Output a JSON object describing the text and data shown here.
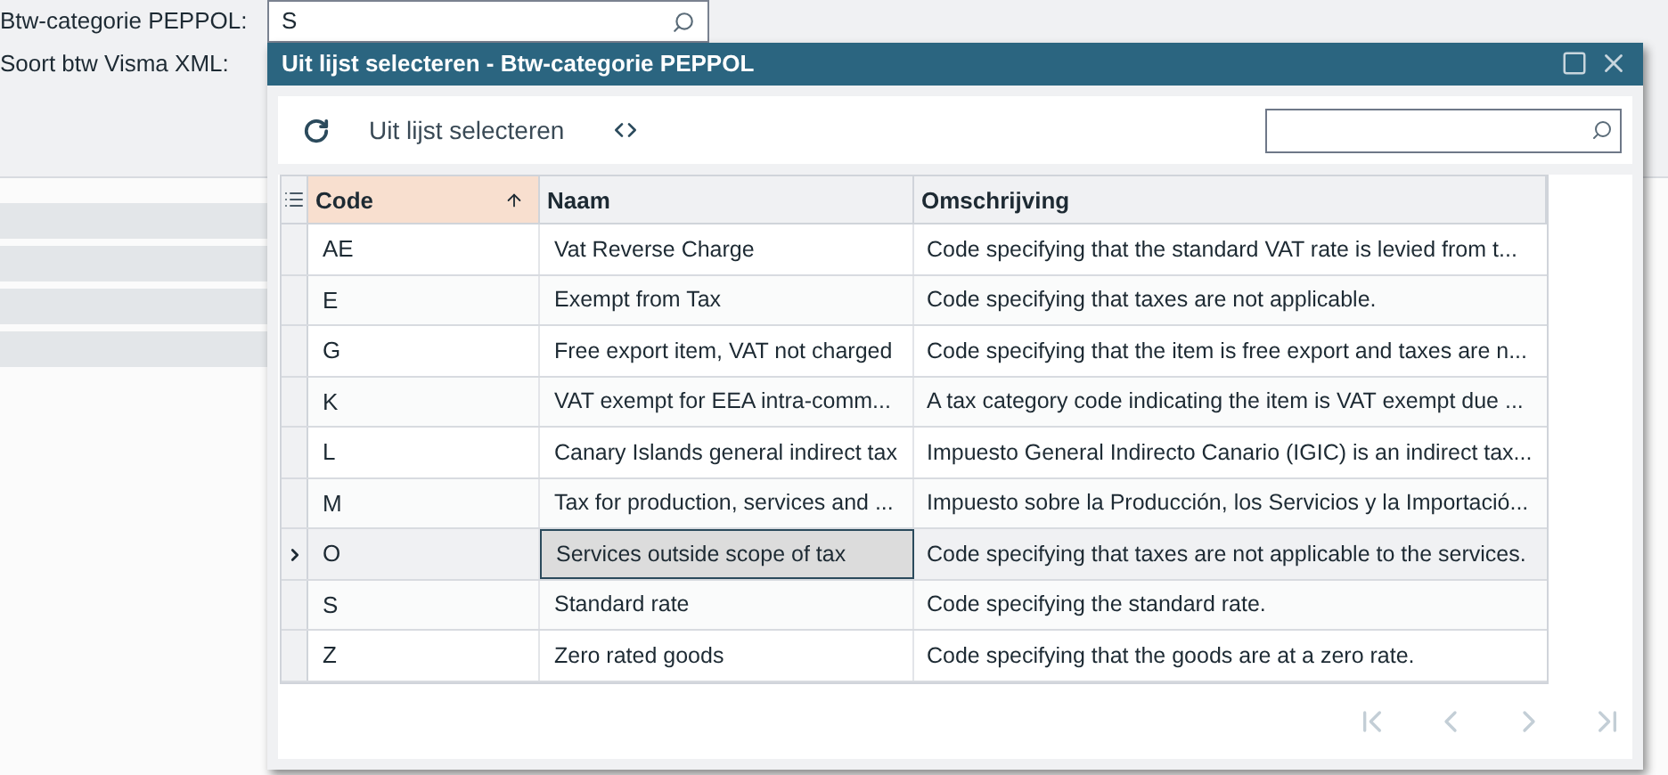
{
  "form": {
    "fields": [
      {
        "label": "Btw-categorie PEPPOL:",
        "value": "S",
        "kind": "lookup"
      },
      {
        "label": "Soort btw Visma XML:",
        "kind": "plain"
      }
    ]
  },
  "dialog": {
    "title": "Uit lijst selecteren - Btw-categorie PEPPOL",
    "toolbar": {
      "select_button": "Uit lijst selecteren"
    },
    "table": {
      "columns": [
        {
          "label": "Code",
          "sorted": true
        },
        {
          "label": "Naam",
          "sorted": false
        },
        {
          "label": "Omschrijving",
          "sorted": false
        }
      ],
      "rows": [
        {
          "code": "AE",
          "name": "Vat Reverse Charge",
          "description": "Code specifying that the standard VAT rate is levied from t...",
          "selected": false
        },
        {
          "code": "E",
          "name": "Exempt from Tax",
          "description": "Code specifying that taxes are not applicable.",
          "selected": false
        },
        {
          "code": "G",
          "name": "Free export item, VAT not charged",
          "description": "Code specifying that the item is free export and taxes are n...",
          "selected": false
        },
        {
          "code": "K",
          "name": "VAT exempt for EEA intra-comm...",
          "description": "A tax category code indicating the item is VAT exempt due ...",
          "selected": false
        },
        {
          "code": "L",
          "name": "Canary Islands general indirect tax",
          "description": "Impuesto General Indirecto Canario (IGIC) is an indirect tax...",
          "selected": false
        },
        {
          "code": "M",
          "name": "Tax for production, services and ...",
          "description": "Impuesto sobre la Producción, los Servicios y la Importació...",
          "selected": false
        },
        {
          "code": "O",
          "name": "Services outside scope of tax",
          "description": "Code specifying that taxes are not applicable to the services.",
          "selected": true
        },
        {
          "code": "S",
          "name": "Standard rate",
          "description": "Code specifying the standard rate.",
          "selected": false
        },
        {
          "code": "Z",
          "name": "Zero rated goods",
          "description": "Code specifying that the goods are at a zero rate.",
          "selected": false
        }
      ]
    },
    "pager": [
      {
        "kind": "first",
        "disabled": true
      },
      {
        "kind": "prev",
        "disabled": true
      },
      {
        "kind": "next",
        "disabled": true
      },
      {
        "kind": "last",
        "disabled": true
      }
    ]
  }
}
